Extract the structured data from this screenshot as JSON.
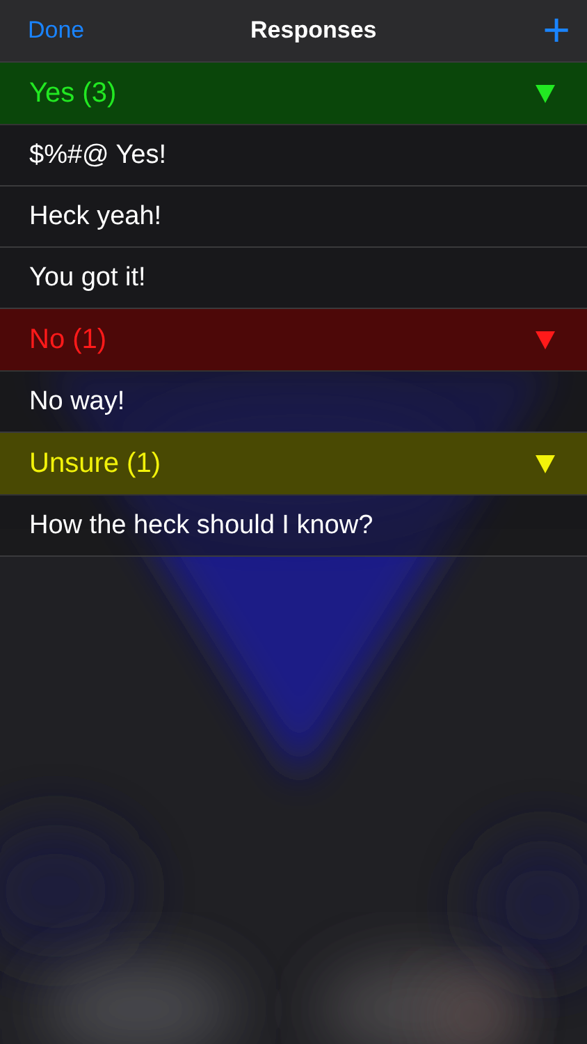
{
  "nav": {
    "left": "Done",
    "title": "Responses",
    "right": "+"
  },
  "groups": [
    {
      "label": "Yes (3)",
      "color": "#22e822",
      "expanded": true,
      "items": [
        "$%#@ Yes!",
        "Heck yeah!",
        "You got it!"
      ]
    },
    {
      "label": "No (1)",
      "color": "#ff1a1a",
      "expanded": true,
      "items": [
        "No way!"
      ]
    },
    {
      "label": "Unsure (1)",
      "color": "#f2f20a",
      "expanded": true,
      "items": [
        "How the heck should I know?"
      ]
    }
  ]
}
